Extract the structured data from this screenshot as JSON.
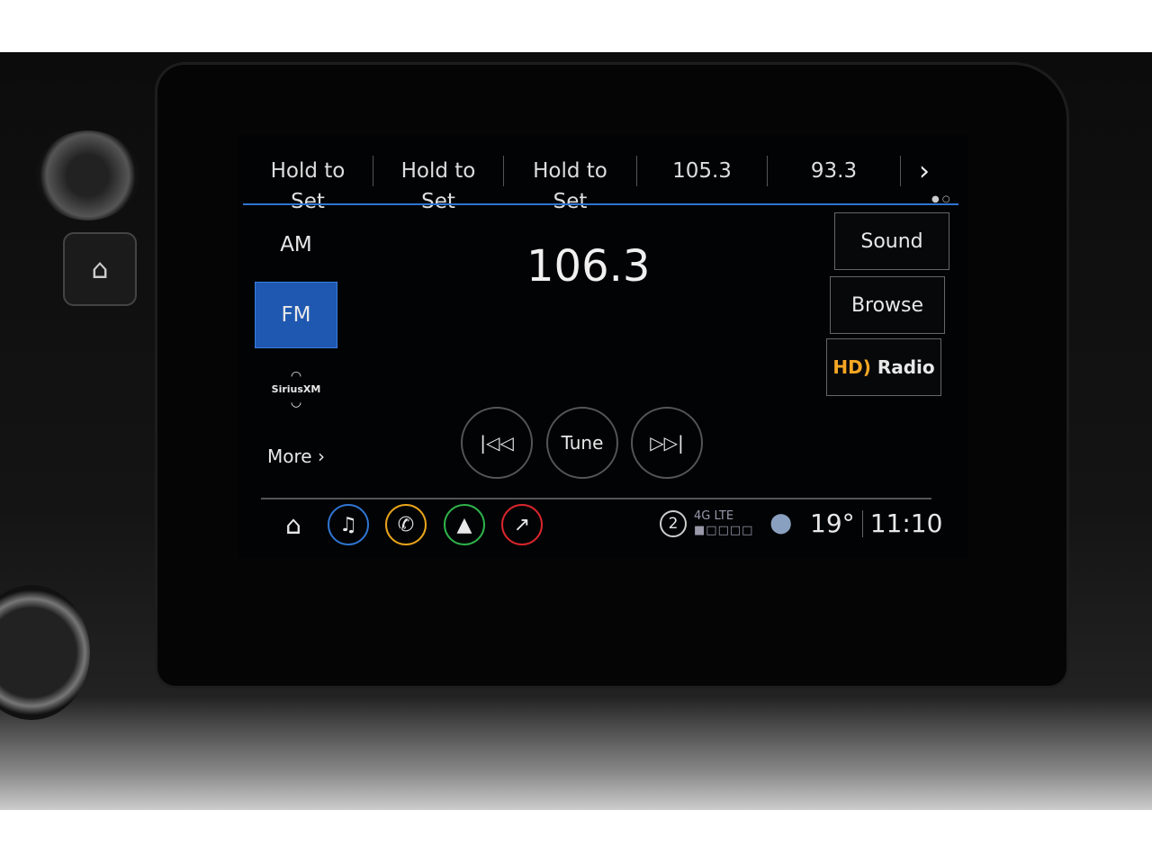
{
  "presets": [
    {
      "label": "Hold to Set"
    },
    {
      "label": "Hold to Set"
    },
    {
      "label": "Hold to Set"
    },
    {
      "label": "105.3"
    },
    {
      "label": "93.3"
    }
  ],
  "presets_next_icon": "chevron-right-icon",
  "bands": {
    "am": "AM",
    "fm": "FM",
    "sirius": "SiriusXM",
    "more": "More"
  },
  "active_band": "FM",
  "frequency": "106.3",
  "side_buttons": {
    "sound": "Sound",
    "browse": "Browse",
    "hd_radio": "HD Radio"
  },
  "controls": {
    "seek_back_icon": "skip-back-icon",
    "tune": "Tune",
    "seek_forward_icon": "skip-forward-icon"
  },
  "nav_icons": [
    {
      "name": "home-icon"
    },
    {
      "name": "music-icon",
      "color": "#2f74d0"
    },
    {
      "name": "phone-icon",
      "color": "#e8a41c"
    },
    {
      "name": "navigation-icon",
      "color": "#2fb24a"
    },
    {
      "name": "onstar-icon",
      "color": "#d8262c"
    }
  ],
  "status": {
    "notifications": "2",
    "network": "4G LTE",
    "signal_bars": 1,
    "signal_max": 5,
    "temperature": "19°",
    "time": "11:10"
  },
  "colors": {
    "accent": "#2f74d0",
    "hd_orange": "#f5a623"
  }
}
